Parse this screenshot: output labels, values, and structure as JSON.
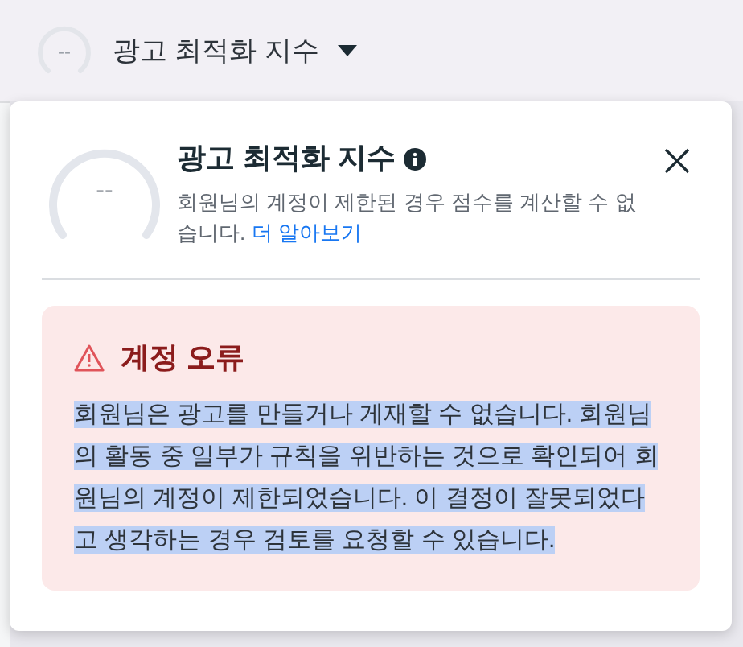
{
  "header": {
    "gauge_value": "--",
    "title": "광고 최적화 지수"
  },
  "popup": {
    "gauge_value": "--",
    "title": "광고 최적화 지수",
    "description": "회원님의 계정이 제한된 경우 점수를 계산할 수 없습니다.",
    "link": "더 알아보기",
    "error": {
      "title": "계정 오류",
      "message": "회원님은 광고를 만들거나 게재할 수 없습니다. 회원님의 활동 중 일부가 규칙을 위반하는 것으로 확인되어 회원님의 계정이 제한되었습니다. 이 결정이 잘못되었다고 생각하는 경우 검토를 요청할 수 있습니다.",
      "selected": true
    }
  }
}
